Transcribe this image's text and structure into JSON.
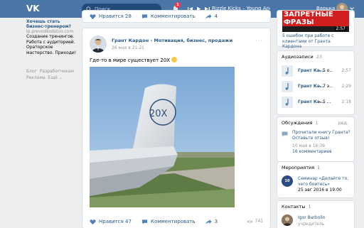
{
  "topbar": {
    "logo": "VK",
    "search_placeholder": "Поиск",
    "notifications_count": "1",
    "now_playing": "Rizzle Kicks – Young And Hot",
    "user_name": "Варька"
  },
  "left": {
    "ad_title": "Хочешь стать бизнес-тренером?",
    "ad_domain": "lp.prevodkodstvo.com",
    "ad_text": "Создание тренингов. Работа с аудиторией. Ораторское мастерство. Приходи!",
    "footer_links": [
      "Блог",
      "Разработчикам",
      "Реклама",
      "Ещё ⌄"
    ]
  },
  "top_post": {
    "likes_label": "Нравится",
    "likes_count": "28",
    "comment_label": "Комментировать",
    "shares": "4"
  },
  "post": {
    "author": "Грант Кардон - Мотивация, бизнес, продажи",
    "date": "26 мая в 21:21",
    "menu": "···",
    "text": "Где-то в мире существует 20X",
    "tail_text": "20X",
    "likes_label": "Нравится",
    "likes_count": "47",
    "comment_label": "Комментировать",
    "shares": "3",
    "views": "741"
  },
  "sidebar": {
    "promo": {
      "word": "ЗАПРЕТНЫЕ ФРАЗЫ",
      "duration": "2:57",
      "text": "5 ошибок при работе с клиентами от Гранта Кардона"
    },
    "audio": {
      "title": "Аудиозаписи",
      "count": "23",
      "tracks": [
        {
          "artist": "Грант Ка...",
          "sep": "–",
          "song": "5 о...",
          "duration": "2:57"
        },
        {
          "artist": "Грант Ка...",
          "sep": "–",
          "song": "7 э...",
          "duration": "2:29"
        },
        {
          "artist": "Грант Ка...",
          "sep": "–",
          "song": "5 ...",
          "duration": "2:18"
        }
      ]
    },
    "discussions": {
      "title": "Обсуждения",
      "count": "1",
      "edit": "ред.",
      "topic": "Прочитали книгу Гранта? Оставьте отзыв!",
      "meta": "10 мая в 16:39",
      "comments": "16 комментариев"
    },
    "events": {
      "title": "Мероприятия",
      "count": "1",
      "logo_text": "10",
      "event_title": "Семинар «Делайте то, чего боитесь»",
      "event_date": "25 авг 2016 в 19:00"
    },
    "contacts": {
      "title": "Контакты",
      "count": "1",
      "name": "Igor Barbolin",
      "role": "учредитель"
    }
  },
  "colors": {
    "brand": "#4a76a8",
    "link": "#2a5885",
    "muted": "#939393",
    "background": "#edeef0"
  }
}
